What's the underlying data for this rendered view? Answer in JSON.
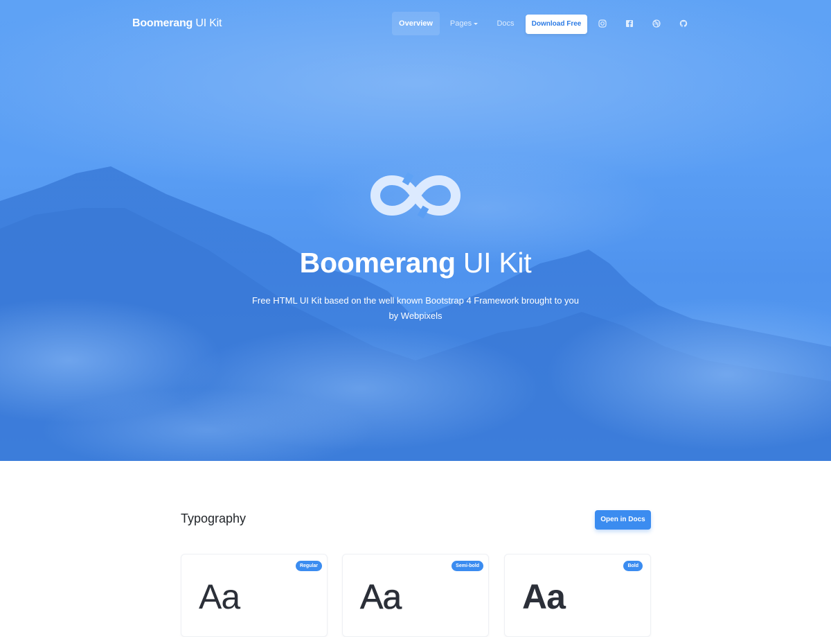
{
  "navbar": {
    "brand_bold": "Boomerang",
    "brand_rest": " UI Kit",
    "items": [
      {
        "label": "Overview"
      },
      {
        "label": "Pages"
      },
      {
        "label": "Docs"
      }
    ],
    "download_label": "Download Free",
    "social_icons": [
      "instagram-icon",
      "facebook-icon",
      "dribbble-icon",
      "github-icon"
    ]
  },
  "hero": {
    "title_bold": "Boomerang",
    "title_rest": " UI Kit",
    "subtitle": "Free HTML UI Kit based on the well known Bootstrap 4 Framework brought to you by Webpixels",
    "logo_icon": "infinity-icon"
  },
  "typography": {
    "title": "Typography",
    "docs_button": "Open in Docs",
    "cards": [
      {
        "badge": "Regular",
        "sample": "Aa"
      },
      {
        "badge": "Semi-bold",
        "sample": "Aa"
      },
      {
        "badge": "Bold",
        "sample": "Aa"
      }
    ]
  },
  "colors": {
    "primary": "#3b8cf0",
    "hero_blue": "#5a9ef4",
    "text_dark": "#212529"
  }
}
